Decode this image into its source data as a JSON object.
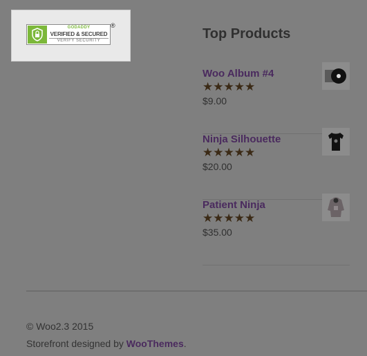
{
  "seal": {
    "brand": "GODADDY",
    "line1": "VERIFIED & SECURED",
    "line2": "VERIFY SECURITY",
    "registered": "®",
    "icon": "lock-icon"
  },
  "widget": {
    "title": "Top Products",
    "products": [
      {
        "name": "Woo Album #4",
        "stars": "★★★★★",
        "price": "$9.00",
        "icon": "vinyl-album-icon"
      },
      {
        "name": "Ninja Silhouette",
        "stars": "★★★★★",
        "price": "$20.00",
        "icon": "tshirt-icon"
      },
      {
        "name": "Patient Ninja",
        "stars": "★★★★★",
        "price": "$35.00",
        "icon": "hoodie-icon"
      }
    ]
  },
  "footer": {
    "copyright": "© Woo2.3 2015",
    "designed_by": "Storefront designed by ",
    "link": "WooThemes",
    "period": "."
  },
  "colors": {
    "overlay": "#7f7f7f",
    "link": "#4a2a5e",
    "star": "#3b2a16",
    "seal_green": "#7cb83a"
  }
}
